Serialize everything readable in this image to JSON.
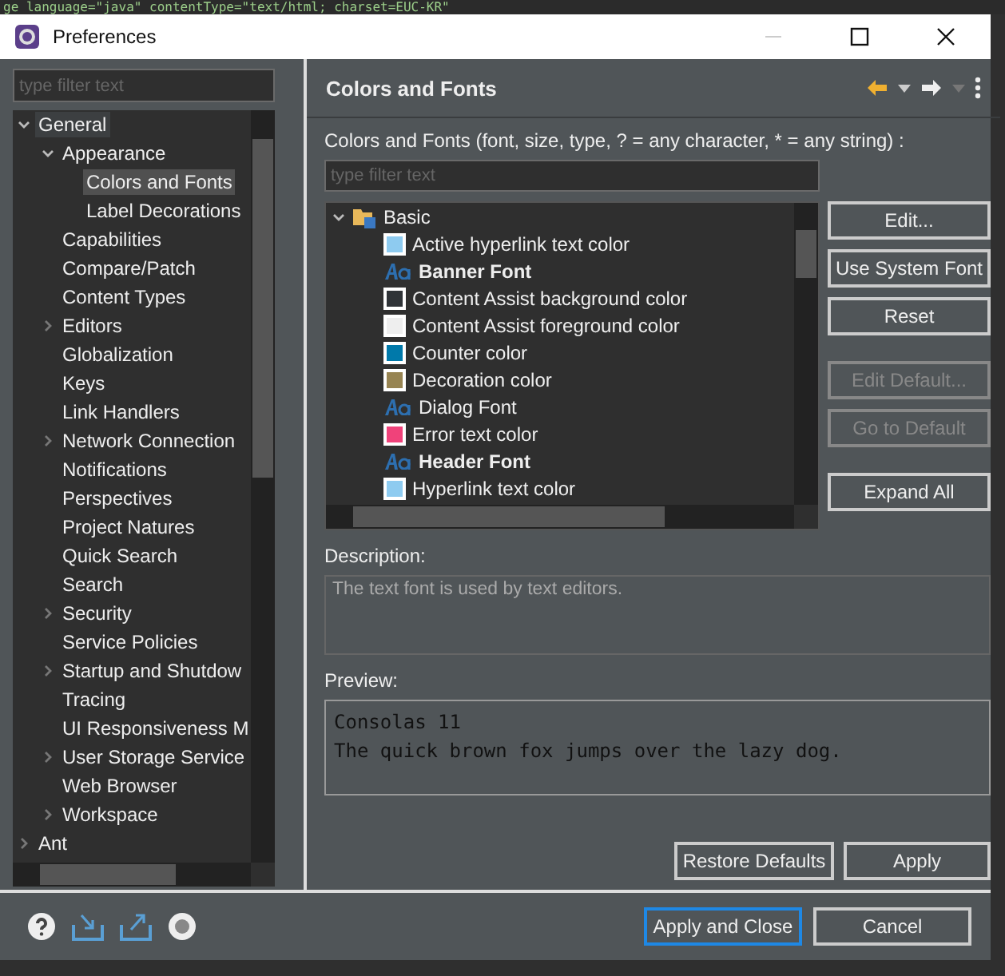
{
  "background_editor": {
    "text": "ge language=\"java\" contentType=\"text/html; charset=EUC-KR\""
  },
  "window": {
    "title": "Preferences"
  },
  "sidebar": {
    "filter": {
      "placeholder": "type filter text"
    },
    "tree": [
      {
        "label": "General",
        "expanded": true,
        "selected": false,
        "focused": true,
        "children": [
          {
            "label": "Appearance",
            "expanded": true,
            "selected": false,
            "focused": false,
            "children": [
              {
                "label": "Colors and Fonts",
                "selected": true,
                "focused": false
              },
              {
                "label": "Label Decorations",
                "selected": false,
                "focused": false
              }
            ]
          },
          {
            "label": "Capabilities",
            "selected": false,
            "focused": false
          },
          {
            "label": "Compare/Patch",
            "selected": false,
            "focused": false
          },
          {
            "label": "Content Types",
            "selected": false,
            "focused": false
          },
          {
            "label": "Editors",
            "expanded": false,
            "selected": false,
            "focused": false
          },
          {
            "label": "Globalization",
            "selected": false,
            "focused": false
          },
          {
            "label": "Keys",
            "selected": false,
            "focused": false
          },
          {
            "label": "Link Handlers",
            "selected": false,
            "focused": false
          },
          {
            "label": "Network Connection",
            "expanded": false,
            "selected": false,
            "focused": false
          },
          {
            "label": "Notifications",
            "selected": false,
            "focused": false
          },
          {
            "label": "Perspectives",
            "selected": false,
            "focused": false
          },
          {
            "label": "Project Natures",
            "selected": false,
            "focused": false
          },
          {
            "label": "Quick Search",
            "selected": false,
            "focused": false
          },
          {
            "label": "Search",
            "selected": false,
            "focused": false
          },
          {
            "label": "Security",
            "expanded": false,
            "selected": false,
            "focused": false
          },
          {
            "label": "Service Policies",
            "selected": false,
            "focused": false
          },
          {
            "label": "Startup and Shutdow",
            "expanded": false,
            "selected": false,
            "focused": false
          },
          {
            "label": "Tracing",
            "selected": false,
            "focused": false
          },
          {
            "label": "UI Responsiveness M",
            "selected": false,
            "focused": false
          },
          {
            "label": "User Storage Service",
            "expanded": false,
            "selected": false,
            "focused": false
          },
          {
            "label": "Web Browser",
            "selected": false,
            "focused": false
          },
          {
            "label": "Workspace",
            "expanded": false,
            "selected": false,
            "focused": false
          }
        ]
      },
      {
        "label": "Ant",
        "expanded": false,
        "selected": false,
        "focused": false
      }
    ]
  },
  "page": {
    "title": "Colors and Fonts",
    "filter_label": "Colors and Fonts (font, size, type, ? = any character, * = any string) :",
    "filter": {
      "placeholder": "type filter text"
    },
    "category": {
      "label": "Basic",
      "expanded": true
    },
    "entries": [
      {
        "kind": "color",
        "label": "Active hyperlink text color",
        "color": "#8ecbf0"
      },
      {
        "kind": "font",
        "label": "Banner Font",
        "bold": true
      },
      {
        "kind": "color",
        "label": "Content Assist background color",
        "color": "#2f3337"
      },
      {
        "kind": "color",
        "label": "Content Assist foreground color",
        "color": "#eeeeee"
      },
      {
        "kind": "color",
        "label": "Counter color",
        "color": "#0079aa"
      },
      {
        "kind": "color",
        "label": "Decoration color",
        "color": "#978452"
      },
      {
        "kind": "font",
        "label": "Dialog Font",
        "bold": false
      },
      {
        "kind": "color",
        "label": "Error text color",
        "color": "#f0427a"
      },
      {
        "kind": "font",
        "label": "Header Font",
        "bold": true
      },
      {
        "kind": "color",
        "label": "Hyperlink text color",
        "color": "#8ecbf0"
      }
    ],
    "side_buttons": [
      {
        "label": "Edit...",
        "disabled": false
      },
      {
        "label": "Use System Font",
        "disabled": false
      },
      {
        "label": "Reset",
        "disabled": false
      },
      {
        "label": "Edit Default...",
        "disabled": true
      },
      {
        "label": "Go to Default",
        "disabled": true
      },
      {
        "label": "Expand All",
        "disabled": false
      }
    ],
    "description_label": "Description:",
    "description": "The text font is used by text editors.",
    "preview_label": "Preview:",
    "preview_lines": [
      "Consolas 11",
      "The quick brown fox jumps over the lazy dog."
    ],
    "page_buttons": [
      {
        "label": "Restore Defaults"
      },
      {
        "label": "Apply"
      }
    ]
  },
  "footer_buttons": [
    {
      "label": "Apply and Close",
      "default": true
    },
    {
      "label": "Cancel",
      "default": false
    }
  ]
}
